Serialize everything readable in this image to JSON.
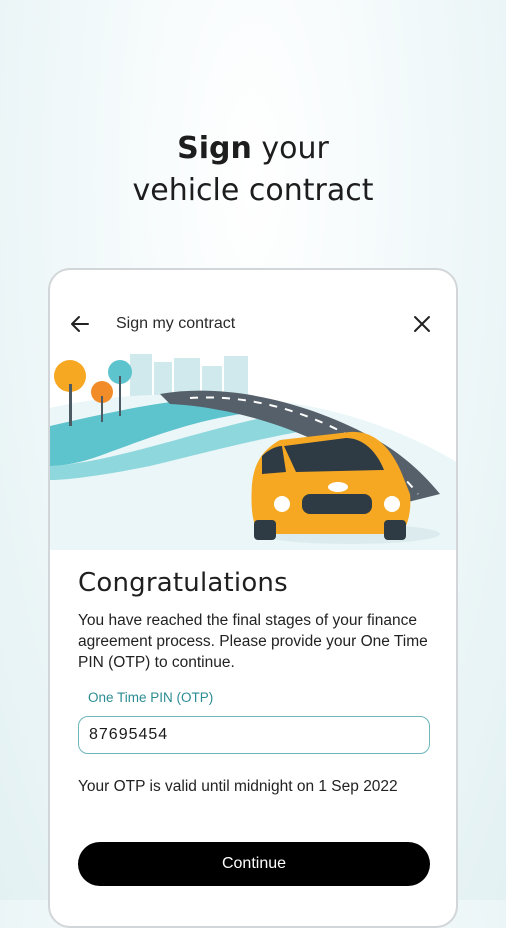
{
  "headline": {
    "bold": "Sign",
    "rest_line1": " your",
    "line2": "vehicle contract"
  },
  "screen": {
    "title": "Sign my contract",
    "heading": "Congratulations",
    "description": "You have reached the final stages of your finance agreement process. Please provide your One Time PIN (OTP) to continue.",
    "otp_label": "One Time PIN (OTP)",
    "otp_value": "87695454",
    "validity": "Your OTP is valid until midnight on 1 Sep 2022",
    "continue_label": "Continue",
    "icons": {
      "back": "back-arrow-icon",
      "close": "close-icon"
    },
    "colors": {
      "accent": "#2c8c93",
      "button": "#000000",
      "car": "#f7a823"
    }
  }
}
